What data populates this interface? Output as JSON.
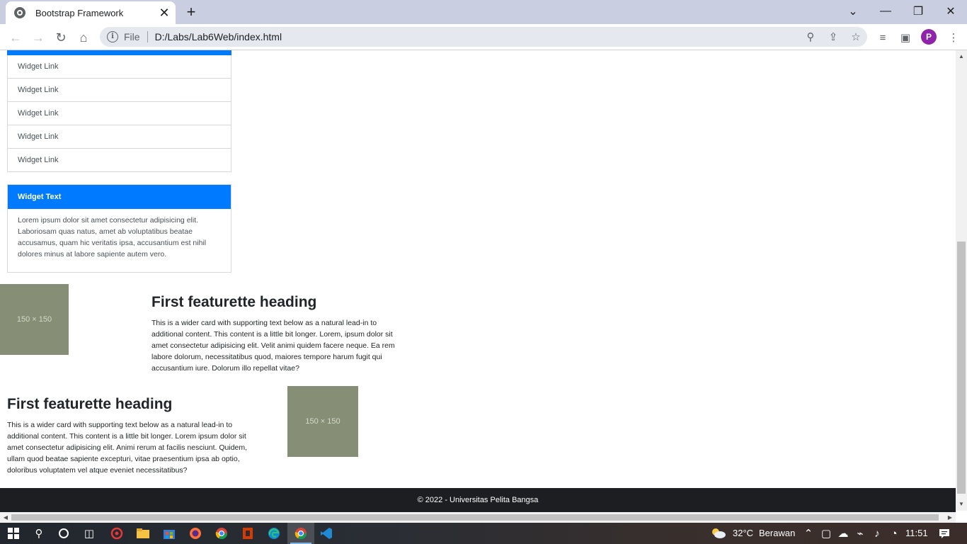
{
  "browser": {
    "tab_title": "Bootstrap Framework",
    "tab_close": "✕",
    "new_tab": "+",
    "omnibox_scheme": "File",
    "url": "D:/Labs/Lab6Web/index.html",
    "profile_initial": "P"
  },
  "sidebar": {
    "widget_links": [
      "Widget Link",
      "Widget Link",
      "Widget Link",
      "Widget Link",
      "Widget Link"
    ],
    "widget_text": {
      "title": "Widget Text",
      "body": "Lorem ipsum dolor sit amet consectetur adipisicing elit. Laboriosam quas natus, amet ab voluptatibus beatae accusamus, quam hic veritatis ipsa, accusantium est nihil dolores minus at labore sapiente autem vero."
    }
  },
  "featurettes": [
    {
      "heading": "First featurette heading",
      "text": "This is a wider card with supporting text below as a natural lead-in to additional content. This content is a little bit longer. Lorem, ipsum dolor sit amet consectetur adipisicing elit. Velit animi quidem facere neque. Ea rem labore dolorum, necessitatibus quod, maiores tempore harum fugit qui accusantium iure. Dolorum illo repellat vitae?",
      "image_label": "150 × 150"
    },
    {
      "heading": "First featurette heading",
      "text": "This is a wider card with supporting text below as a natural lead-in to additional content. This content is a little bit longer. Lorem ipsum dolor sit amet consectetur adipisicing elit. Animi rerum at facilis nesciunt. Quidem, ullam quod beatae sapiente excepturi, vitae praesentium ipsa ab optio, doloribus voluptatem vel atque eveniet necessitatibus?",
      "image_label": "150 × 150"
    }
  ],
  "footer": {
    "text": "© 2022 - Universitas Pelita Bangsa"
  },
  "taskbar": {
    "weather_temp": "32°C",
    "weather_desc": "Berawan",
    "time": "11:51"
  },
  "colors": {
    "primary": "#007bff",
    "footer_bg": "#1d1e21",
    "placeholder_bg": "#868e75"
  }
}
